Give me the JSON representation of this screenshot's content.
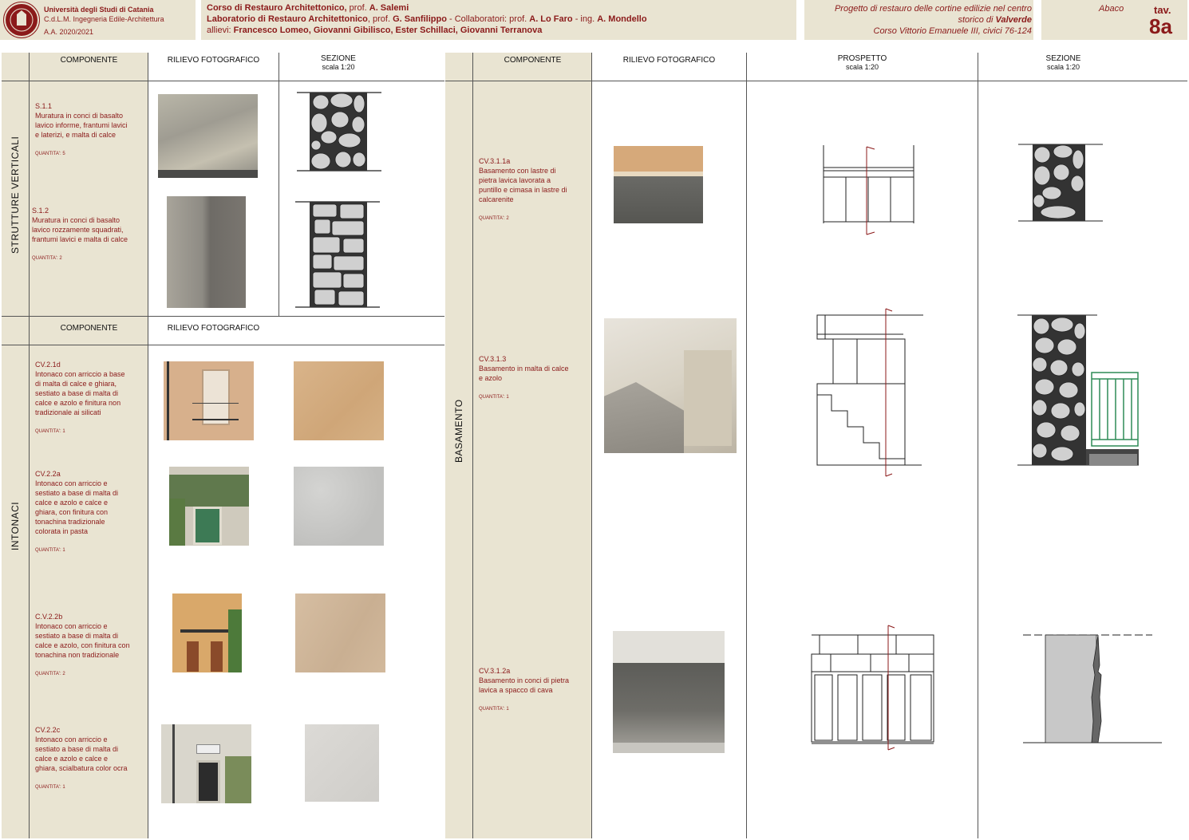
{
  "header": {
    "university": "Università degli Studi di Catania",
    "degree": "C.d.L.M. Ingegneria Edile-Architettura",
    "year": "A.A. 2020/2021",
    "course1_prefix": "Corso di Restauro Architettonico, ",
    "course1_prof": "prof. ",
    "course1_name": "A. Salemi",
    "course2_prefix": "Laboratorio di Restauro Architettonico",
    "course2_prof": ", prof. ",
    "course2_name": "G. Sanfilippo",
    "course2_collab": " - Collaboratori: prof. ",
    "course2_c1": "A. Lo Faro",
    "course2_sep": " - ing. ",
    "course2_c2": "A. Mondello",
    "students_label": "allievi: ",
    "students": "Francesco Lomeo, Giovanni Gibilisco, Ester Schillaci, Giovanni Terranova",
    "project_line1": "Progetto di restauro delle cortine edilizie nel centro",
    "project_line2a": "storico di ",
    "project_line2b": "Valverde",
    "project_line3": "Corso Vittorio Emanuele III, civici 76-124",
    "abaco": "Abaco",
    "tav_label": "tav.",
    "tav_num": "8a"
  },
  "left": {
    "col_componente": "COMPONENTE",
    "col_rilievo": "RILIEVO FOTOGRAFICO",
    "col_sezione": "SEZIONE",
    "col_scala": "scala 1:20",
    "section1": "STRUTTURE VERTICALI",
    "section2": "INTONACI",
    "col2_componente": "COMPONENTE",
    "col2_rilievo": "RILIEVO FOTOGRAFICO",
    "items": [
      {
        "code": "S.1.1",
        "desc1": "Muratura in conci di basalto",
        "desc2": "lavico informe, frantumi lavici",
        "desc3": "e laterizi, e malta di calce",
        "desc4": "",
        "desc5": "",
        "desc6": "",
        "qty": "QUANTITA': 5"
      },
      {
        "code": "S.1.2",
        "desc1": "Muratura in conci di basalto",
        "desc2": "lavico rozzamente squadrati,",
        "desc3": "frantumi lavici e malta di calce",
        "desc4": "",
        "desc5": "",
        "desc6": "",
        "qty": "QUANTITA': 2"
      },
      {
        "code": "CV.2.1d",
        "desc1": "Intonaco con arriccio a base",
        "desc2": "di malta di calce e ghiara,",
        "desc3": "sestiato a base di malta di",
        "desc4": "calce e azolo e finitura non",
        "desc5": "tradizionale ai silicati",
        "desc6": "",
        "qty": "QUANTITA': 1"
      },
      {
        "code": "CV.2.2a",
        "desc1": "Intonaco con arriccio e",
        "desc2": "sestiato a base di malta di",
        "desc3": "calce e azolo e calce e",
        "desc4": "ghiara, con finitura con",
        "desc5": "tonachina tradizionale",
        "desc6": "colorata in pasta",
        "qty": "QUANTITA': 1"
      },
      {
        "code": "C.V.2.2b",
        "desc1": "Intonaco con arriccio e",
        "desc2": "sestiato a base di malta di",
        "desc3": "calce e azolo, con finitura con",
        "desc4": "tonachina non tradizionale",
        "desc5": "",
        "desc6": "",
        "qty": "QUANTITA': 2"
      },
      {
        "code": "CV.2.2c",
        "desc1": "Intonaco con arriccio e",
        "desc2": "sestiato a base di malta di",
        "desc3": "calce e azolo e calce e",
        "desc4": "ghiara, scialbatura color ocra",
        "desc5": "",
        "desc6": "",
        "qty": "QUANTITA': 1"
      }
    ]
  },
  "right": {
    "col_componente": "COMPONENTE",
    "col_rilievo": "RILIEVO FOTOGRAFICO",
    "col_prospetto": "PROSPETTO",
    "col_sezione": "SEZIONE",
    "col_scala": "scala 1:20",
    "section": "BASAMENTO",
    "items": [
      {
        "code": "CV.3.1.1a",
        "desc1": "Basamento con lastre di",
        "desc2": "pietra lavica lavorata a",
        "desc3": "puntillo e cimasa in lastre di",
        "desc4": "calcarenite",
        "qty": "QUANTITA': 2"
      },
      {
        "code": "CV.3.1.3",
        "desc1": "Basamento in malta di calce",
        "desc2": "e azolo",
        "desc3": "",
        "desc4": "",
        "qty": "QUANTITA': 1"
      },
      {
        "code": "CV.3.1.2a",
        "desc1": "Basamento in conci di pietra",
        "desc2": "lavica a spacco di cava",
        "desc3": "",
        "desc4": "",
        "qty": "QUANTITA': 1"
      }
    ]
  },
  "colors": {
    "beige": "#e9e4d2",
    "accent": "#8b1a1a",
    "stone": "#c8c8c8",
    "railing": "#2e8b57"
  }
}
